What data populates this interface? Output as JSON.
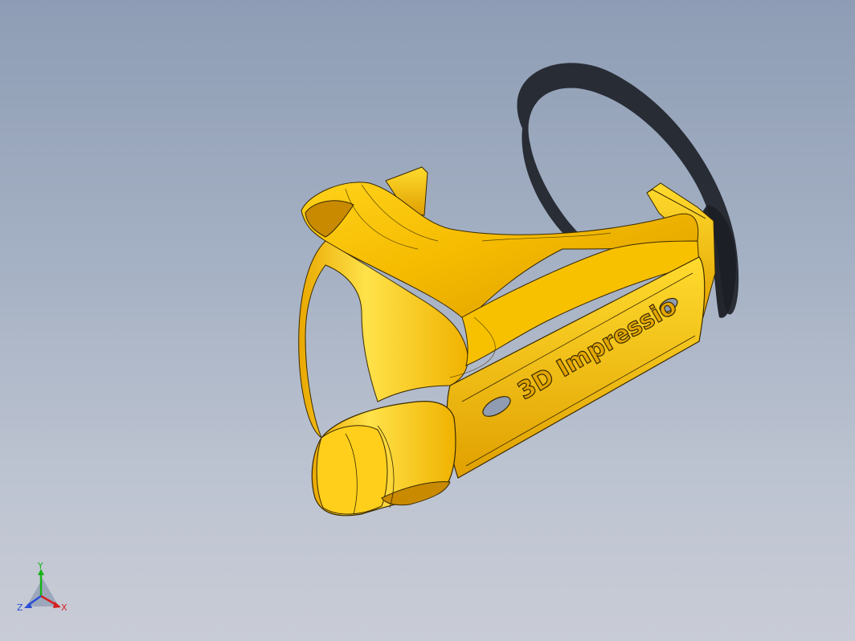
{
  "viewport": {
    "background_top": "#8e9db5",
    "background_bottom": "#c9ccd6"
  },
  "model": {
    "engraved_text": "3D Impressio",
    "body_color": "#f2b600",
    "highlight_color": "#ffe566",
    "shade_color": "#c98a00",
    "edge_color": "#3a2a00",
    "shadow_color": "#1c1f26"
  },
  "triad": {
    "x_label": "X",
    "y_label": "Y",
    "z_label": "Z",
    "x_color": "#d42020",
    "y_color": "#19b319",
    "z_color": "#2a4fd6"
  }
}
